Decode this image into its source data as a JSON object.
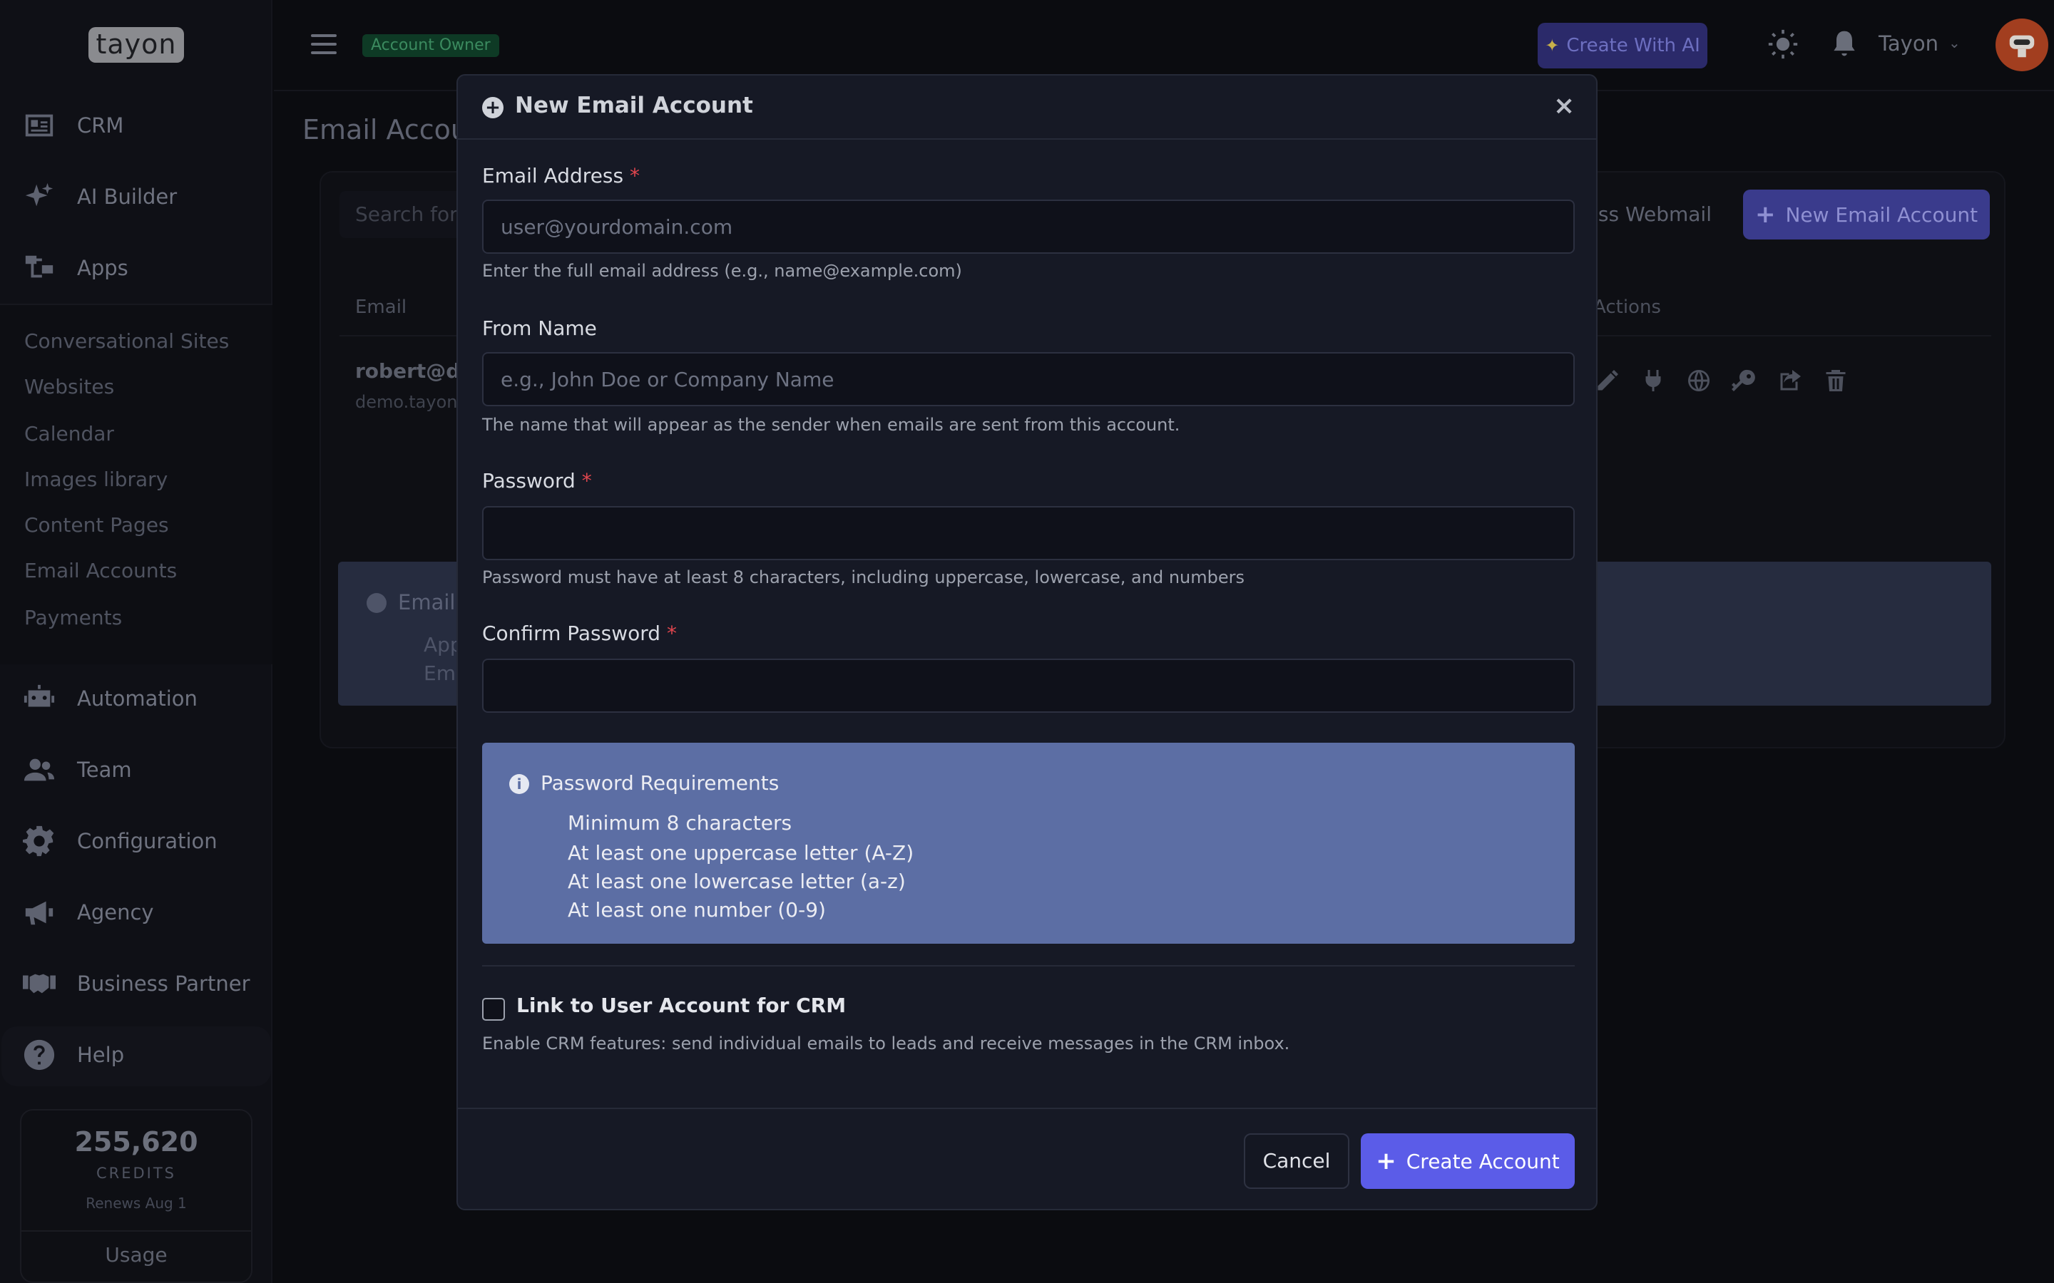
{
  "brand": {
    "logo": "tayon"
  },
  "sidebar": {
    "items": [
      {
        "label": "CRM",
        "icon": "id-card-icon"
      },
      {
        "label": "AI Builder",
        "icon": "sparkles-icon"
      },
      {
        "label": "Apps",
        "icon": "sitemap-icon"
      },
      {
        "label": "Automation",
        "icon": "robot-icon"
      },
      {
        "label": "Team",
        "icon": "users-icon"
      },
      {
        "label": "Configuration",
        "icon": "gear-icon"
      },
      {
        "label": "Agency",
        "icon": "megaphone-icon"
      },
      {
        "label": "Business Partner",
        "icon": "handshake-icon"
      },
      {
        "label": "Help",
        "icon": "question-icon"
      }
    ],
    "apps_sub": [
      "Conversational Sites",
      "Websites",
      "Calendar",
      "Images library",
      "Content Pages",
      "Email Accounts",
      "Payments"
    ],
    "credits": {
      "value": "255,620",
      "label": "CREDITS",
      "renews": "Renews Aug 1",
      "usage": "Usage"
    }
  },
  "topbar": {
    "role_badge": "Account Owner",
    "ai_button": "Create With AI",
    "user_name": "Tayon"
  },
  "page": {
    "title": "Email Accou",
    "search_placeholder": "Search for",
    "webmail_button": "ss Webmail",
    "new_button": "New Email Account",
    "col_email": "Email",
    "col_actions": "Actions",
    "row_email": "robert@de",
    "row_sub": "demo.tayon",
    "info_title": "Email",
    "info_line1": "App",
    "info_line2": "Em"
  },
  "modal": {
    "title": "New Email Account",
    "close": "×",
    "email": {
      "label": "Email Address",
      "required": "*",
      "value": "",
      "placeholder": "user@yourdomain.com",
      "help": "Enter the full email address (e.g., name@example.com)"
    },
    "from_name": {
      "label": "From Name",
      "value": "",
      "placeholder": "e.g., John Doe or Company Name",
      "help": "The name that will appear as the sender when emails are sent from this account."
    },
    "password": {
      "label": "Password",
      "required": "*",
      "value": "",
      "help": "Password must have at least 8 characters, including uppercase, lowercase, and numbers"
    },
    "confirm_password": {
      "label": "Confirm Password",
      "required": "*",
      "value": ""
    },
    "requirements": {
      "title": "Password Requirements",
      "items": [
        "Minimum 8 characters",
        "At least one uppercase letter (A-Z)",
        "At least one lowercase letter (a-z)",
        "At least one number (0-9)"
      ]
    },
    "link_crm": {
      "label": "Link to User Account for CRM",
      "checked": false,
      "help": "Enable CRM features: send individual emails to leads and receive messages in the CRM inbox."
    },
    "cancel": "Cancel",
    "create": "Create Account"
  },
  "colors": {
    "accent": "#5b5ce8",
    "info_box": "#5c6ea4",
    "required": "#e0464e",
    "avatar": "#a23e1f",
    "badge_green": "#3b8a5f"
  }
}
